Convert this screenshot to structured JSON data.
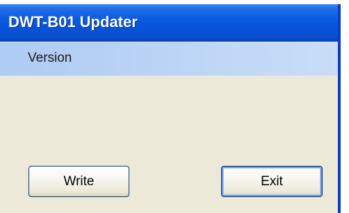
{
  "window": {
    "title": "DWT-B01 Updater"
  },
  "main": {
    "version_label": "Version"
  },
  "buttons": {
    "write_label": "Write",
    "exit_label": "Exit"
  },
  "colors": {
    "titlebar": "#0a5ce0",
    "version_band": "#bdd5f6",
    "window_body": "#ece9d8",
    "button_border": "#003c74"
  }
}
